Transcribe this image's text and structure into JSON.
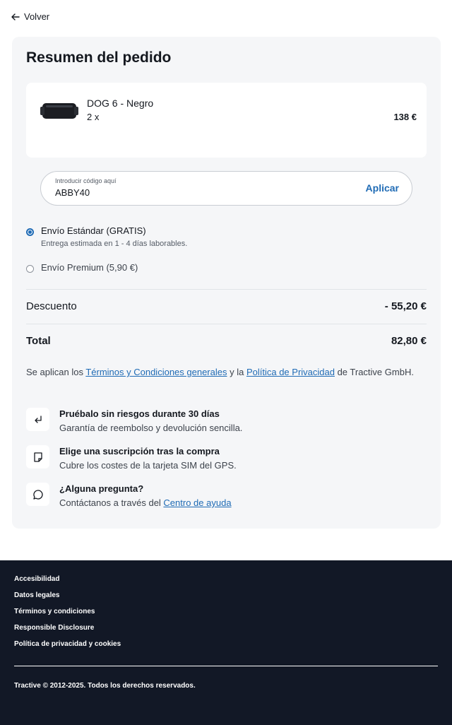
{
  "nav": {
    "back_label": "Volver"
  },
  "summary": {
    "title": "Resumen del pedido",
    "product": {
      "name": "DOG 6 - Negro",
      "quantity": "2 x",
      "price": "138 €"
    },
    "coupon": {
      "label": "Introducir código aquí",
      "value": "ABBY40",
      "apply_label": "Aplicar"
    },
    "shipping": [
      {
        "label": "Envío Estándar (GRATIS)",
        "sub": "Entrega estimada en 1 - 4 días laborables.",
        "selected": true
      },
      {
        "label": "Envío Premium (5,90 €)",
        "selected": false
      }
    ],
    "discount": {
      "label": "Descuento",
      "value": "- 55,20 €"
    },
    "total": {
      "label": "Total",
      "value": "82,80 €"
    },
    "terms": {
      "prefix": "Se aplican los ",
      "link1": "Términos y Condiciones generales",
      "middle": " y la ",
      "link2": "Política de Privacidad",
      "suffix": " de Tractive GmbH."
    },
    "features": [
      {
        "icon": "return-arrow-icon",
        "title": "Pruébalo sin riesgos durante 30 días",
        "desc": "Garantía de reembolso y devolución sencilla."
      },
      {
        "icon": "sim-card-icon",
        "title": "Elige una suscripción tras la compra",
        "desc": "Cubre los costes de la tarjeta SIM del GPS."
      },
      {
        "icon": "chat-bubble-icon",
        "title": "¿Alguna pregunta?",
        "desc_prefix": "Contáctanos a través del ",
        "desc_link": "Centro de ayuda"
      }
    ]
  },
  "footer": {
    "links": [
      "Accesibilidad",
      "Datos legales",
      "Términos y condiciones",
      "Responsible Disclosure",
      "Política de privacidad y cookies"
    ],
    "copyright": "Tractive © 2012-2025. Todos los derechos reservados."
  },
  "colors": {
    "accent": "#1f6bb5",
    "card_bg": "#f5f6f8",
    "footer_bg": "#121826"
  }
}
